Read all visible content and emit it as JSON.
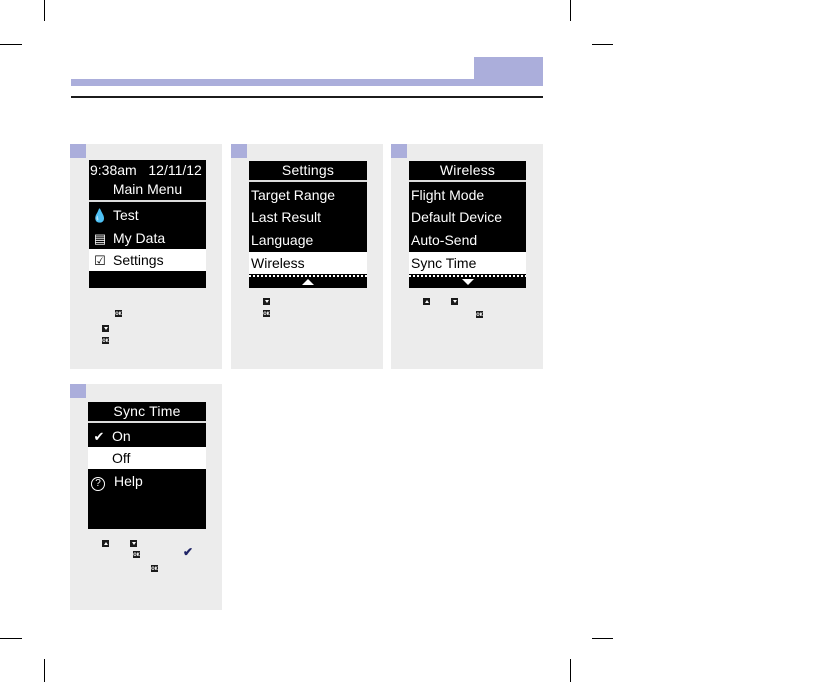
{
  "header": {
    "accent_color": "#abaedb",
    "rule_color": "#1c1c1c"
  },
  "steps": [
    {
      "screen": {
        "title_lines": [
          "9:38am   12/11/12",
          "Main Menu"
        ],
        "items": [
          {
            "icon": "drop-icon",
            "glyph": "▲",
            "label": "Test",
            "selected": false
          },
          {
            "icon": "my-data-icon",
            "glyph": "▤",
            "label": "My Data",
            "selected": false
          },
          {
            "icon": "checkbox-icon",
            "glyph": "☑",
            "label": "Settings",
            "selected": true
          }
        ]
      },
      "instruction_buttons": [
        "OK",
        "down",
        "OK"
      ]
    },
    {
      "screen": {
        "title": "Settings",
        "items": [
          {
            "label": "Target Range",
            "selected": false
          },
          {
            "label": "Last Result",
            "selected": false
          },
          {
            "label": "Language",
            "selected": false
          },
          {
            "label": "Wireless",
            "selected": true
          }
        ],
        "scroll_indicator": "up"
      },
      "instruction_buttons": [
        "down",
        "OK"
      ]
    },
    {
      "screen": {
        "title": "Wireless",
        "items": [
          {
            "label": "Flight Mode",
            "selected": false
          },
          {
            "label": "Default Device",
            "selected": false
          },
          {
            "label": "Auto-Send",
            "selected": false
          },
          {
            "label": "Sync Time",
            "selected": true
          }
        ],
        "scroll_indicator": "down"
      },
      "instruction_buttons": [
        "up",
        "down",
        "OK"
      ]
    },
    {
      "screen": {
        "title": "Sync Time",
        "items": [
          {
            "icon": "checkmark-icon",
            "glyph": "✔",
            "label": "On",
            "selected": false
          },
          {
            "icon": "",
            "glyph": "",
            "label": "Off",
            "selected": true
          },
          {
            "icon": "help-icon",
            "glyph": "?",
            "label": "Help",
            "selected": false
          }
        ]
      },
      "instruction_buttons": [
        "up",
        "down",
        "OK",
        "checkmark",
        "OK"
      ]
    }
  ],
  "button_labels": {
    "ok": "OK"
  },
  "checkmark_glyph": "✔"
}
